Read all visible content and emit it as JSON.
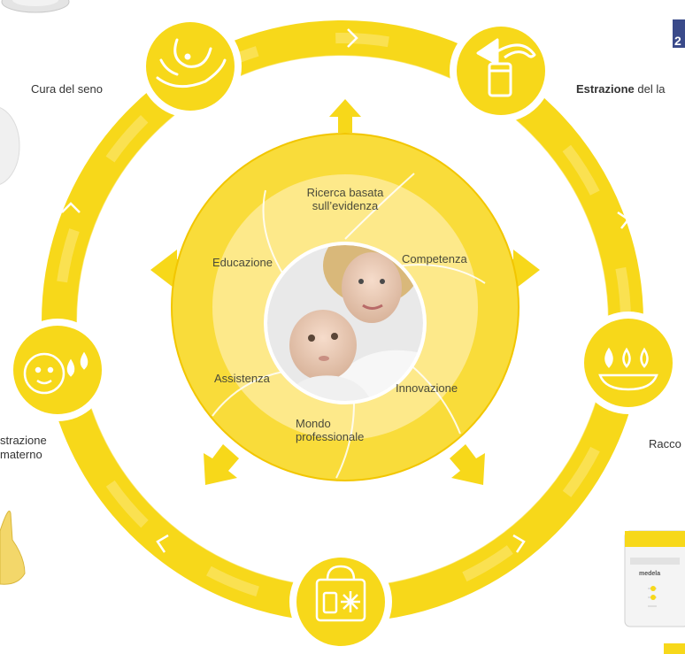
{
  "colors": {
    "ring": "#f7d81a",
    "ring_light": "#fbe66a",
    "inner": "#f9dc3a",
    "inner_light": "#fde98a",
    "circle_stroke": "#f2c600",
    "text": "#333333"
  },
  "outer_labels": {
    "breast_care": "Cura del seno",
    "expression_bold": "Estrazione",
    "expression_rest": " del la",
    "feeding_line1": "strazione",
    "feeding_line2": " materno",
    "collection": "Racco"
  },
  "inner_segments": {
    "research_line1": "Ricerca basata",
    "research_line2": "sull’evidenza",
    "competence": "Competenza",
    "education": "Educazione",
    "innovation": "Innovazione",
    "assistance": "Assistenza",
    "professional_line1": "Mondo",
    "professional_line2": "professionale"
  },
  "product_brand": "medela",
  "corner_badge": "2",
  "icons": [
    "breast-care-hand-icon",
    "breast-pump-icon",
    "milk-drops-bowl-icon",
    "cooler-bag-icon",
    "baby-feeding-icon",
    "center-photo"
  ]
}
